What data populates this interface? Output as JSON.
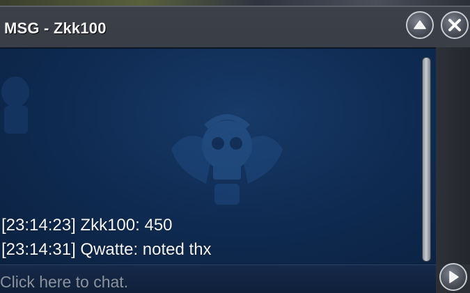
{
  "window": {
    "title": "MSG - Zkk100"
  },
  "controls": {
    "minimize_icon": "chevron-up-icon",
    "close_icon": "close-icon",
    "send_icon": "play-arrow-icon"
  },
  "messages": [
    {
      "text": "[23:14:23] Zkk100: 450"
    },
    {
      "text": "[23:14:31] Qwatte: noted thx"
    }
  ],
  "input": {
    "placeholder": "Click here to chat.",
    "value": ""
  },
  "colors": {
    "chat_background": "#0f2b52",
    "chrome": "#3c4049",
    "text": "#f5f6f8"
  }
}
